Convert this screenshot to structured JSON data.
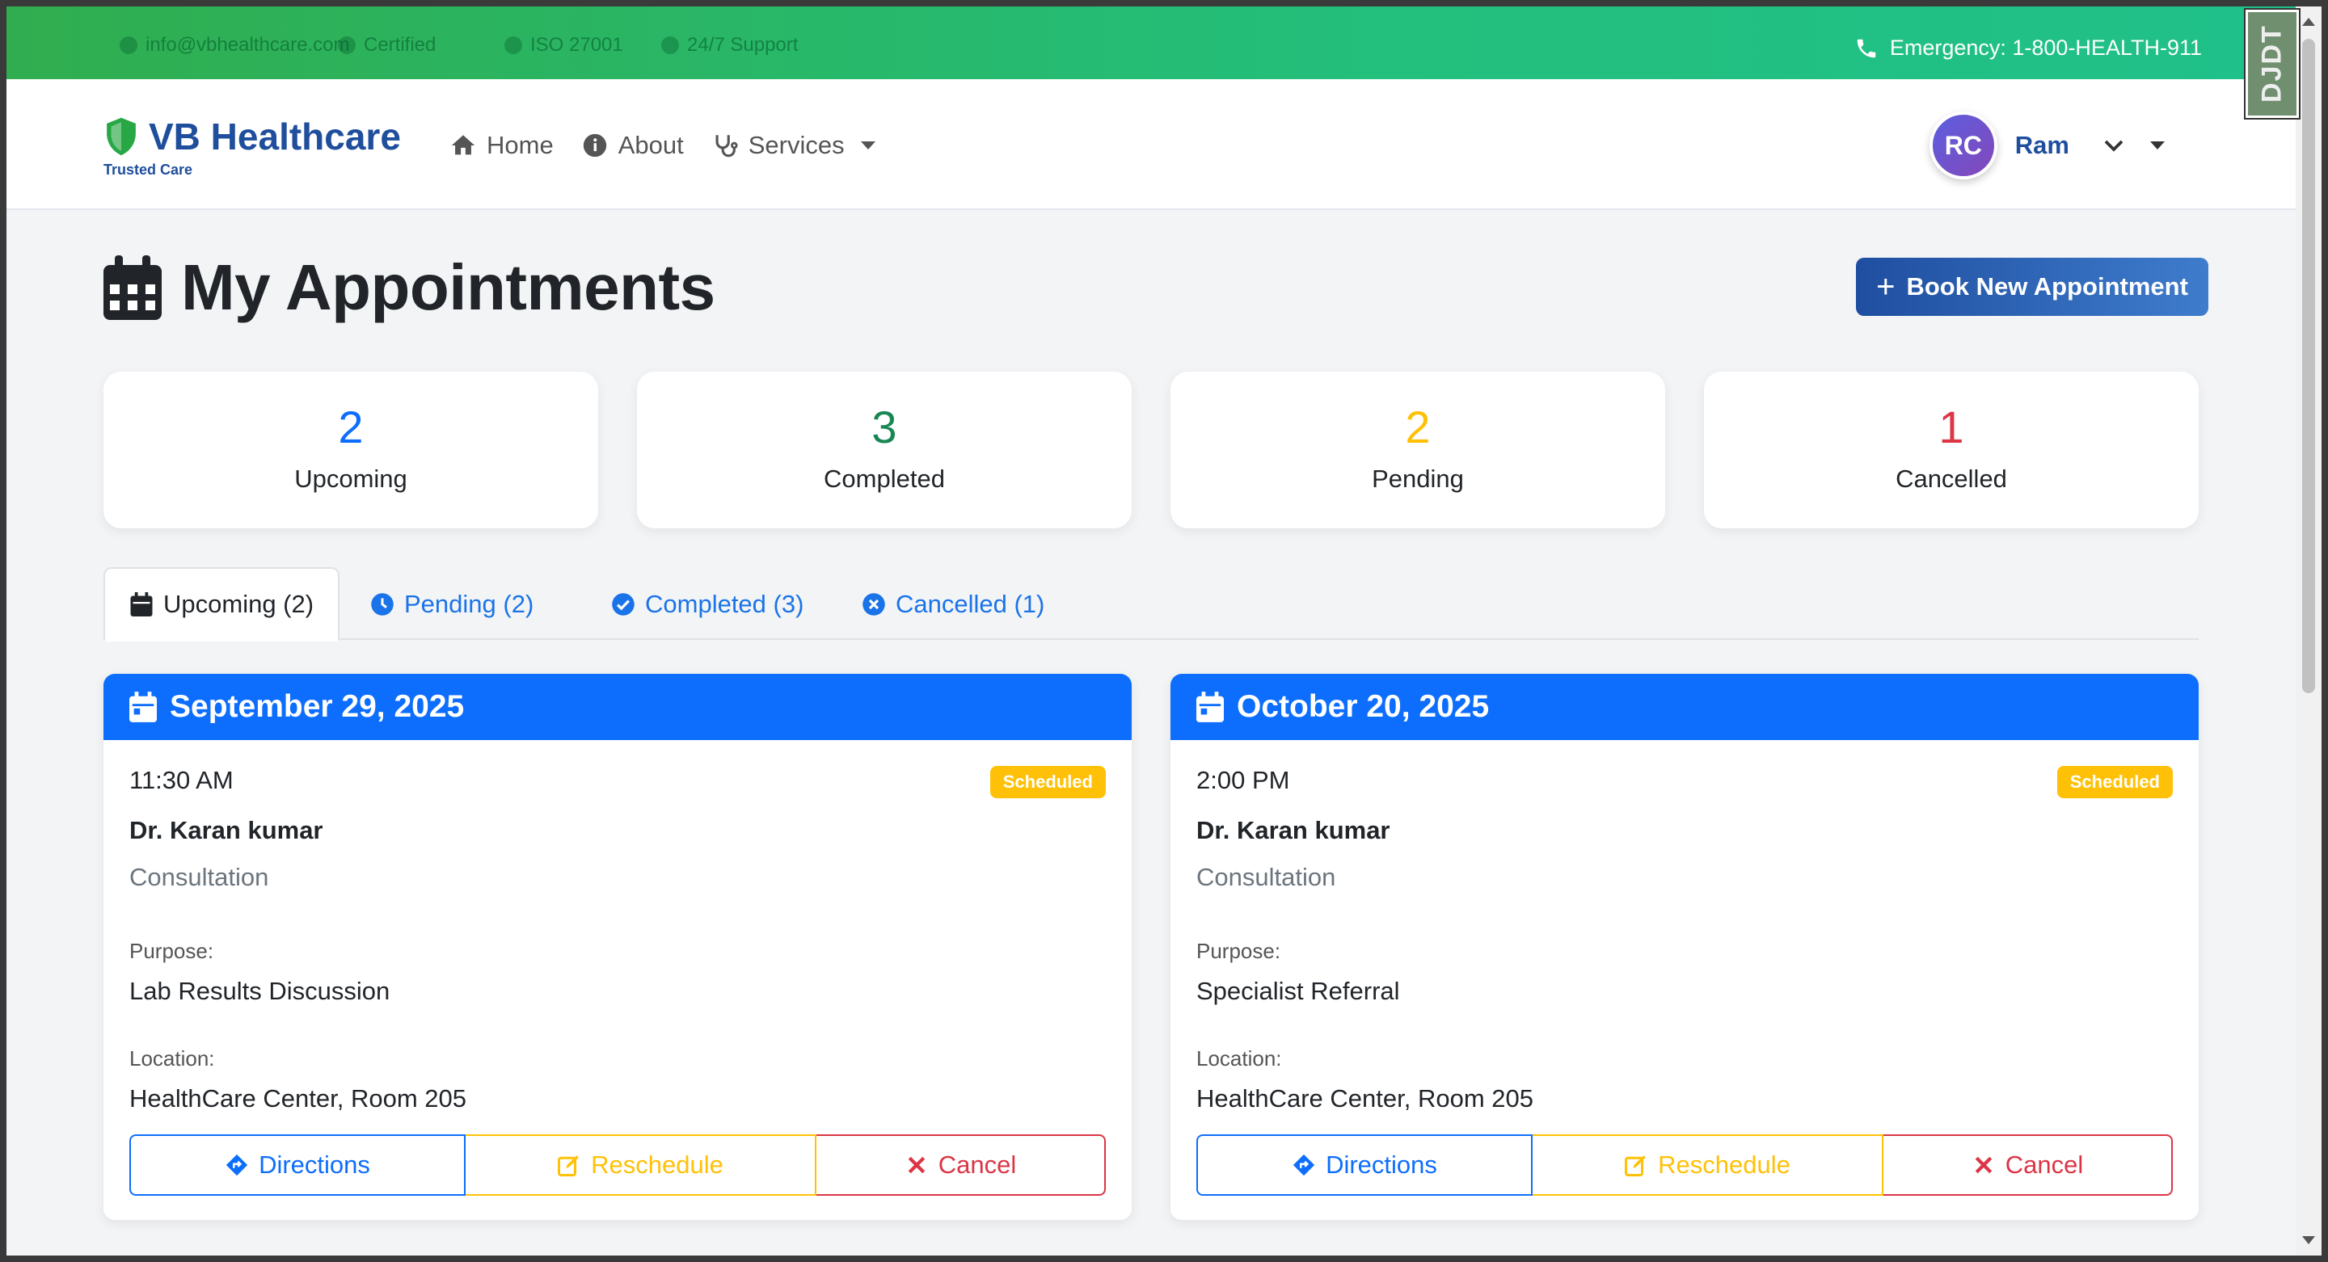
{
  "topbar": {
    "ghost_items": [
      "info@vbhealthcare.com",
      "Certified",
      "ISO 27001",
      "24/7 Support"
    ],
    "emergency": "Emergency: 1-800-HEALTH-911"
  },
  "brand": {
    "name": "VB Healthcare",
    "tagline": "Trusted Care"
  },
  "nav": {
    "home": "Home",
    "about": "About",
    "services": "Services"
  },
  "user": {
    "initials": "RC",
    "name": "Ram"
  },
  "page": {
    "title": "My Appointments",
    "book_button": "Book New Appointment"
  },
  "stats": [
    {
      "value": "2",
      "label": "Upcoming",
      "color": "#0d6efd"
    },
    {
      "value": "3",
      "label": "Completed",
      "color": "#198754"
    },
    {
      "value": "2",
      "label": "Pending",
      "color": "#ffc107"
    },
    {
      "value": "1",
      "label": "Cancelled",
      "color": "#dc3545"
    }
  ],
  "tabs": [
    {
      "label": "Upcoming (2)",
      "active": true
    },
    {
      "label": "Pending (2)"
    },
    {
      "label": "Completed (3)"
    },
    {
      "label": "Cancelled (1)"
    }
  ],
  "appointments": [
    {
      "date": "September 29, 2025",
      "time": "11:30 AM",
      "status": "Scheduled",
      "doctor": "Dr. Karan kumar",
      "type": "Consultation",
      "purpose_label": "Purpose:",
      "purpose": "Lab Results Discussion",
      "location_label": "Location:",
      "location": "HealthCare Center, Room 205",
      "actions": {
        "directions": "Directions",
        "reschedule": "Reschedule",
        "cancel": "Cancel"
      }
    },
    {
      "date": "October 20, 2025",
      "time": "2:00 PM",
      "status": "Scheduled",
      "doctor": "Dr. Karan kumar",
      "type": "Consultation",
      "purpose_label": "Purpose:",
      "purpose": "Specialist Referral",
      "location_label": "Location:",
      "location": "HealthCare Center, Room 205",
      "actions": {
        "directions": "Directions",
        "reschedule": "Reschedule",
        "cancel": "Cancel"
      }
    }
  ],
  "debug_toolbar": {
    "label": "DJDT"
  },
  "colors": {
    "primary": "#0d6efd",
    "brand": "#1f4e9c",
    "warning": "#ffc107",
    "danger": "#dc3545",
    "success": "#198754"
  }
}
